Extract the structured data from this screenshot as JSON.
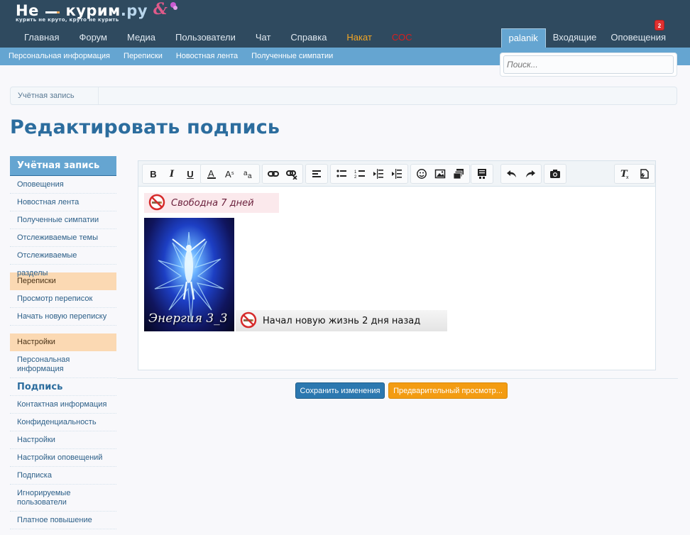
{
  "logo": {
    "title_part1": "Не",
    "title_part2": "курим",
    "title_part3": ".ру",
    "tagline": "курить не круто, круто не курить"
  },
  "main_nav": [
    {
      "label": "Главная"
    },
    {
      "label": "Форум"
    },
    {
      "label": "Медиа"
    },
    {
      "label": "Пользователи"
    },
    {
      "label": "Чат"
    },
    {
      "label": "Справка"
    },
    {
      "label": "Накат"
    },
    {
      "label": "СОС"
    }
  ],
  "user_nav": {
    "username": "palanik",
    "inbox": "Входящие",
    "alerts": "Оповещения",
    "alerts_count": "2"
  },
  "sub_nav": [
    {
      "label": "Персональная информация"
    },
    {
      "label": "Переписки"
    },
    {
      "label": "Новостная лента"
    },
    {
      "label": "Полученные симпатии"
    }
  ],
  "search": {
    "placeholder": "Поиск..."
  },
  "breadcrumb": {
    "item": "Учётная запись"
  },
  "page_title": "Редактировать подпись",
  "sidebar": {
    "header": "Учётная запись",
    "account_items": [
      "Оповещения",
      "Новостная лента",
      "Полученные симпатии",
      "Отслеживаемые темы",
      "Отслеживаемые разделы"
    ],
    "conversations_group": "Переписки",
    "conversations_items": [
      "Просмотр переписок",
      "Начать новую переписку"
    ],
    "settings_group": "Настройки",
    "settings_items": [
      "Персональная информация",
      "Подпись",
      "Контактная информация",
      "Конфиденциальность",
      "Настройки",
      "Настройки оповещений",
      "Подписка",
      "Игнорируемые пользователи",
      "Платное повышение прав"
    ]
  },
  "editor": {
    "toolbar_icons": [
      "bold-icon",
      "italic-icon",
      "underline-icon",
      "font-color-icon",
      "font-size-icon",
      "font-family-icon",
      "link-icon",
      "unlink-icon",
      "align-icon",
      "bullet-list-icon",
      "numbered-list-icon",
      "outdent-icon",
      "indent-icon",
      "smilie-icon",
      "image-icon",
      "media-icon",
      "code-icon",
      "undo-icon",
      "redo-icon",
      "camera-icon",
      "remove-format-icon",
      "toggle-bbcode-icon"
    ],
    "signature_line1": "Свободна 7 дней",
    "image_caption": "Энергия 3_3",
    "signature_line2": "Начал новую жизнь 2 дня назад"
  },
  "buttons": {
    "save": "Сохранить изменения",
    "preview": "Предварительный просмотр..."
  },
  "colors": {
    "header_bg": "#2f4a5f",
    "subnav_bg": "#65a5d1",
    "title_color": "#2c6d9e",
    "save_button": "#2c78b0",
    "preview_button": "#f39c12",
    "nakat": "#f5a623",
    "sos": "#d81e1e"
  }
}
